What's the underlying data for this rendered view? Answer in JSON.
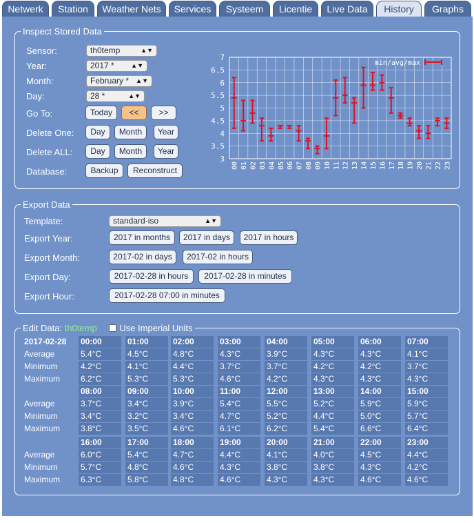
{
  "tabs": [
    "Netwerk",
    "Station",
    "Weather Nets",
    "Services",
    "Systeem",
    "Licentie",
    "Live Data",
    "History",
    "Graphs"
  ],
  "active_tab": "History",
  "inspect": {
    "legend": "Inspect Stored Data",
    "sensor_label": "Sensor:",
    "sensor_value": "th0temp",
    "year_label": "Year:",
    "year_value": "2017 *",
    "month_label": "Month:",
    "month_value": "February *",
    "day_label": "Day:",
    "day_value": "28 *",
    "goto_label": "Go To:",
    "today": "Today",
    "prev": "<<",
    "next": ">>",
    "delete_one_label": "Delete One:",
    "delete_all_label": "Delete ALL:",
    "day": "Day",
    "month": "Month",
    "year": "Year",
    "database_label": "Database:",
    "backup": "Backup",
    "reconstruct": "Reconstruct"
  },
  "chart_data": {
    "type": "errorbar",
    "legend": "min/avg/max",
    "categories": [
      "00",
      "01",
      "02",
      "03",
      "04",
      "05",
      "06",
      "07",
      "08",
      "09",
      "10",
      "11",
      "12",
      "13",
      "14",
      "15",
      "16",
      "17",
      "18",
      "19",
      "20",
      "21",
      "22",
      "23"
    ],
    "avg": [
      5.4,
      4.5,
      4.8,
      4.3,
      3.9,
      4.3,
      4.3,
      4.1,
      3.7,
      3.4,
      3.9,
      5.4,
      5.5,
      5.2,
      5.9,
      5.9,
      6.0,
      5.4,
      4.7,
      4.4,
      4.1,
      4.0,
      4.5,
      4.4
    ],
    "min": [
      4.2,
      4.1,
      4.4,
      3.7,
      3.7,
      4.2,
      4.2,
      3.7,
      3.4,
      3.2,
      3.4,
      4.7,
      5.2,
      4.4,
      5.0,
      5.7,
      5.7,
      4.8,
      4.6,
      4.3,
      3.8,
      3.8,
      4.3,
      4.2
    ],
    "max": [
      6.2,
      5.3,
      5.3,
      4.6,
      4.2,
      4.3,
      4.3,
      4.3,
      3.8,
      3.5,
      4.6,
      6.1,
      6.2,
      5.4,
      6.6,
      6.4,
      6.3,
      5.8,
      4.8,
      4.6,
      4.3,
      4.3,
      4.6,
      4.6
    ],
    "ylim": [
      3,
      7
    ],
    "yticks": [
      "7",
      "6.5",
      "6",
      "5.5",
      "5",
      "4.5",
      "4",
      "3.5",
      "3"
    ],
    "grid": true,
    "legend_position": "top-right",
    "color": "#e01020"
  },
  "export": {
    "legend": "Export Data",
    "template_label": "Template:",
    "template_value": "standard-iso",
    "year_label": "Export Year:",
    "month_label": "Export Month:",
    "day_label": "Export Day:",
    "hour_label": "Export Hour:",
    "year_btns": [
      "2017 in months",
      "2017 in days",
      "2017 in hours"
    ],
    "month_btns": [
      "2017-02 in days",
      "2017-02 in hours"
    ],
    "day_btns": [
      "2017-02-28 in hours",
      "2017-02-28 in minutes"
    ],
    "hour_btns": [
      "2017-02-28 07:00 in minutes"
    ]
  },
  "edit": {
    "legend_prefix": "Edit Data:",
    "sensor": "th0temp",
    "imperial_label": "Use Imperial Units",
    "date": "2017-02-28",
    "row_labels": [
      "Average",
      "Minimum",
      "Maximum"
    ],
    "blocks": [
      {
        "hours": [
          "00:00",
          "01:00",
          "02:00",
          "03:00",
          "04:00",
          "05:00",
          "06:00",
          "07:00"
        ],
        "average": [
          "5.4°C",
          "4.5°C",
          "4.8°C",
          "4.3°C",
          "3.9°C",
          "4.3°C",
          "4.3°C",
          "4.1°C"
        ],
        "minimum": [
          "4.2°C",
          "4.1°C",
          "4.4°C",
          "3.7°C",
          "3.7°C",
          "4.2°C",
          "4.2°C",
          "3.7°C"
        ],
        "maximum": [
          "6.2°C",
          "5.3°C",
          "5.3°C",
          "4.6°C",
          "4.2°C",
          "4.3°C",
          "4.3°C",
          "4.3°C"
        ]
      },
      {
        "hours": [
          "08:00",
          "09:00",
          "10:00",
          "11:00",
          "12:00",
          "13:00",
          "14:00",
          "15:00"
        ],
        "average": [
          "3.7°C",
          "3.4°C",
          "3.9°C",
          "5.4°C",
          "5.5°C",
          "5.2°C",
          "5.9°C",
          "5.9°C"
        ],
        "minimum": [
          "3.4°C",
          "3.2°C",
          "3.4°C",
          "4.7°C",
          "5.2°C",
          "4.4°C",
          "5.0°C",
          "5.7°C"
        ],
        "maximum": [
          "3.8°C",
          "3.5°C",
          "4.6°C",
          "6.1°C",
          "6.2°C",
          "5.4°C",
          "6.6°C",
          "6.4°C"
        ]
      },
      {
        "hours": [
          "16:00",
          "17:00",
          "18:00",
          "19:00",
          "20:00",
          "21:00",
          "22:00",
          "23:00"
        ],
        "average": [
          "6.0°C",
          "5.4°C",
          "4.7°C",
          "4.4°C",
          "4.1°C",
          "4.0°C",
          "4.5°C",
          "4.4°C"
        ],
        "minimum": [
          "5.7°C",
          "4.8°C",
          "4.6°C",
          "4.3°C",
          "3.8°C",
          "3.8°C",
          "4.3°C",
          "4.2°C"
        ],
        "maximum": [
          "6.3°C",
          "5.8°C",
          "4.8°C",
          "4.6°C",
          "4.3°C",
          "4.3°C",
          "4.6°C",
          "4.6°C"
        ]
      }
    ]
  }
}
